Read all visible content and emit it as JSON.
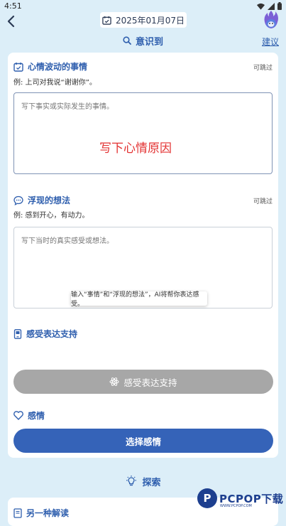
{
  "status": {
    "time": "4:51"
  },
  "header": {
    "date": "2025年01月07日"
  },
  "section": {
    "title": "意识到",
    "suggest_link": "建议"
  },
  "event_field": {
    "title": "心情波动的事情",
    "skip": "可跳过",
    "example": "例: 上司对我说“谢谢你”。",
    "placeholder": "写下事实或实际发生的事情。"
  },
  "thought_field": {
    "title": "浮现的想法",
    "skip": "可跳过",
    "example": "例: 感到开心，有动力。",
    "placeholder": "写下当时的真实感受或想法。"
  },
  "overlay_text": "写下心情原因",
  "support": {
    "title": "感受表达支持",
    "tooltip": "输入“事情”和“浮现的想法”，AI将帮你表达感受。",
    "button_label": "感受表达支持"
  },
  "emotion": {
    "title": "感情",
    "button_label": "选择感情"
  },
  "explore": {
    "title": "探索"
  },
  "next_section": {
    "title": "另一种解读"
  },
  "watermark": {
    "brand": "PCPOP下载",
    "sub": "WWW.PCPOP.COM"
  },
  "colors": {
    "accent": "#3563b8",
    "title_blue": "#2f5fae",
    "background": "#dceef8",
    "disabled": "#a7a7a7",
    "overlay_red": "#e33333"
  }
}
